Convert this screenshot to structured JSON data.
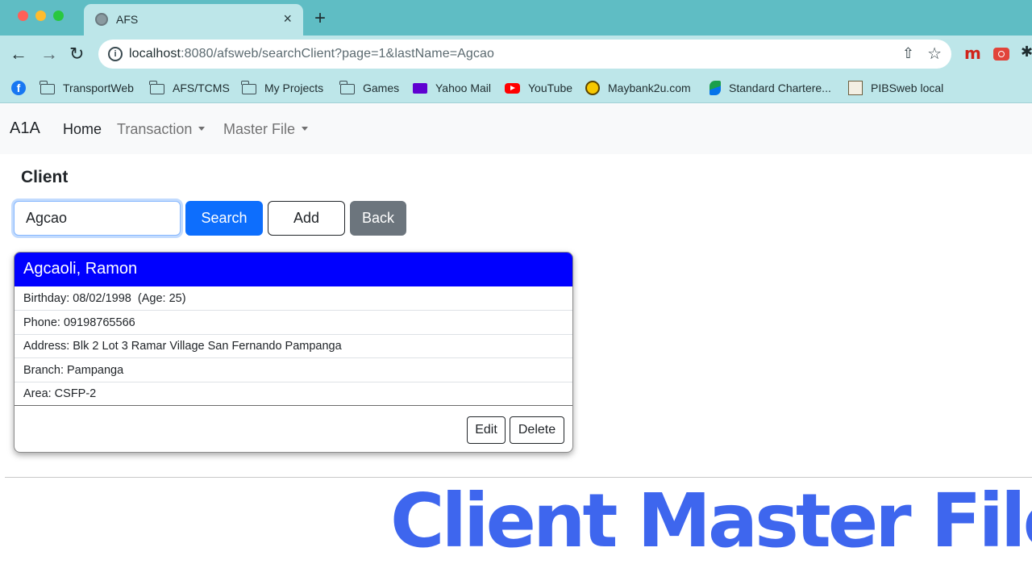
{
  "browser": {
    "tab_title": "AFS",
    "tab_close": "×",
    "new_tab": "+",
    "url_host": "localhost",
    "url_rest": ":8080/afsweb/searchClient?page=1&lastName=Agcao",
    "bookmarks": [
      {
        "label": "",
        "icon": "facebook-icon"
      },
      {
        "label": "TransportWeb",
        "icon": "folder-icon"
      },
      {
        "label": "AFS/TCMS",
        "icon": "folder-icon"
      },
      {
        "label": "My Projects",
        "icon": "folder-icon"
      },
      {
        "label": "Games",
        "icon": "folder-icon"
      },
      {
        "label": "Yahoo Mail",
        "icon": "yahoo-mail-icon"
      },
      {
        "label": "YouTube",
        "icon": "youtube-icon"
      },
      {
        "label": "Maybank2u.com",
        "icon": "maybank-icon"
      },
      {
        "label": "Standard Chartere...",
        "icon": "standard-chartered-icon"
      },
      {
        "label": "PIBSweb local",
        "icon": "pibs-icon"
      }
    ],
    "extensions": {
      "m_label": "m"
    }
  },
  "app": {
    "brand": "A1A",
    "nav": {
      "home": "Home",
      "transaction": "Transaction",
      "master_file": "Master File"
    },
    "page_heading": "Client",
    "search": {
      "value": "Agcao",
      "search_label": "Search",
      "add_label": "Add",
      "back_label": "Back"
    },
    "client_card": {
      "name": "Agcaoli, Ramon",
      "birthday": "Birthday: 08/02/1998  (Age: 25)",
      "phone": "Phone: 09198765566",
      "address": "Address: Blk 2 Lot 3 Ramar Village San Fernando Pampanga",
      "branch": "Branch: Pampanga",
      "area": "Area: CSFP-2",
      "edit_label": "Edit",
      "delete_label": "Delete"
    }
  },
  "overlay": {
    "title": "Client Master File"
  },
  "colors": {
    "tabstrip": "#5fbdc4",
    "toolbar": "#bde6e9",
    "primary": "#0d6efd",
    "card_header": "#0000ff",
    "secondary": "#6c757d",
    "overlay_title": "#3e66ee"
  }
}
